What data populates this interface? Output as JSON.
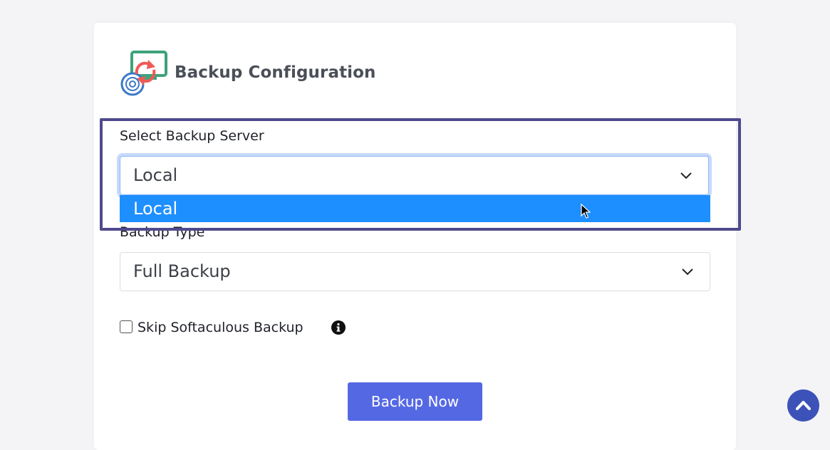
{
  "page": {
    "title": "Backup Configuration"
  },
  "backup_server": {
    "label": "Select Backup Server",
    "selected": "Local",
    "options": [
      "Local"
    ],
    "highlighted_option": "Local"
  },
  "backup_type": {
    "label": "Backup Type",
    "selected": "Full Backup"
  },
  "skip_softaculous": {
    "label": "Skip Softaculous Backup",
    "checked": false
  },
  "actions": {
    "backup_now_label": "Backup Now"
  },
  "icons": {
    "header": "backup-restore-icon",
    "dropdown": "chevron-down-icon",
    "info": "info-icon",
    "scroll_top": "chevron-up-icon",
    "cursor": "mouse-pointer-icon"
  },
  "colors": {
    "accent_button": "#5568e3",
    "dropdown_highlight": "#1e8fff",
    "annotation_border": "#4f4a8c",
    "scroll_top_button": "#3d52b8",
    "focus_ring": "#c7dafb"
  }
}
